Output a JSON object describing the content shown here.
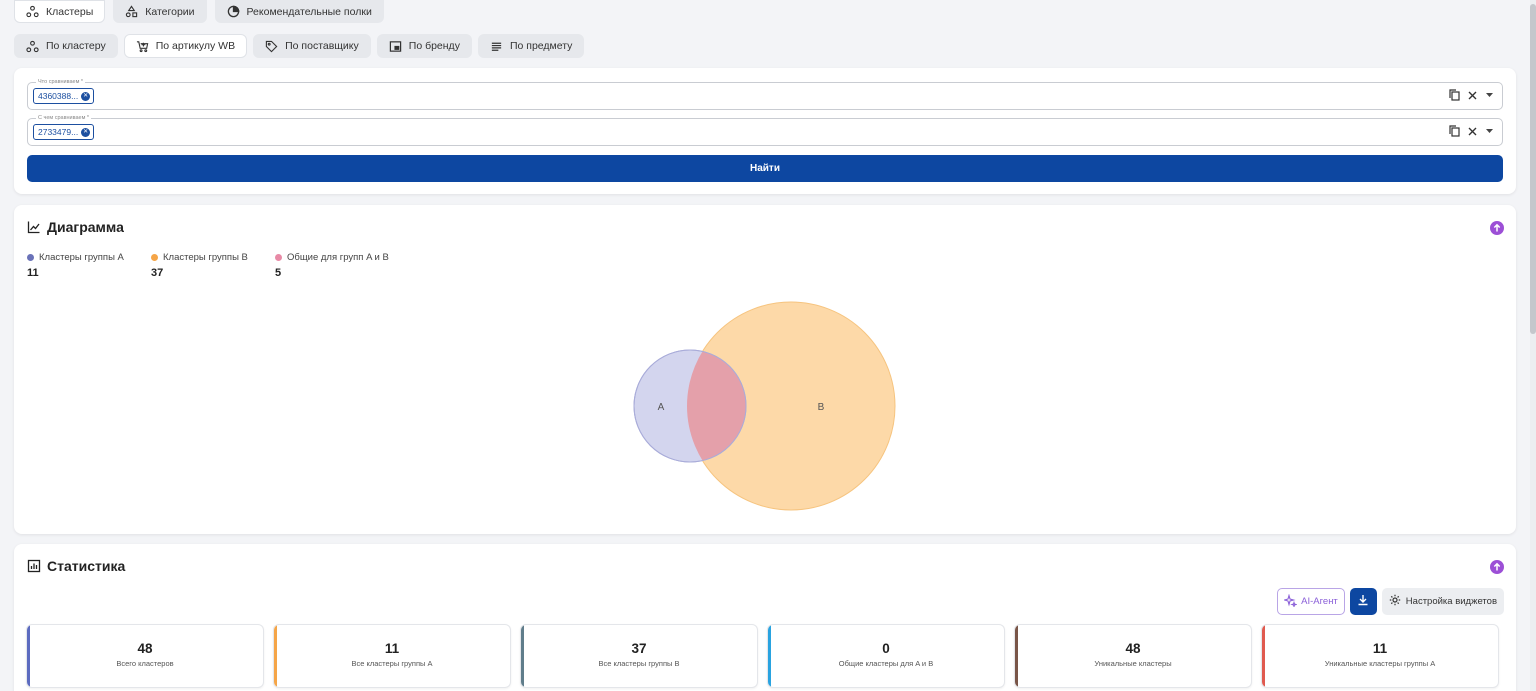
{
  "top_tabs": [
    {
      "label": "Кластеры",
      "icon": "clusters-icon",
      "active": true
    },
    {
      "label": "Категории",
      "icon": "categories-icon",
      "active": false
    },
    {
      "label": "Рекомендательные полки",
      "icon": "pie-icon",
      "active": false
    }
  ],
  "sub_tabs": [
    {
      "label": "По кластеру",
      "icon": "clusters-icon",
      "active": false
    },
    {
      "label": "По артикулу WB",
      "icon": "cart-icon",
      "active": true
    },
    {
      "label": "По поставщику",
      "icon": "tag-icon",
      "active": false
    },
    {
      "label": "По бренду",
      "icon": "brand-icon",
      "active": false
    },
    {
      "label": "По предмету",
      "icon": "lines-icon",
      "active": false
    }
  ],
  "search": {
    "field_a": {
      "label": "Что сравниваем *",
      "chip": "4360388..."
    },
    "field_b": {
      "label": "С чем сравниваем *",
      "chip": "2733479..."
    },
    "find_label": "Найти"
  },
  "diagram": {
    "title": "Диаграмма",
    "legend": [
      {
        "label": "Кластеры группы A",
        "value": "11",
        "color": "#6a72b8"
      },
      {
        "label": "Кластеры группы B",
        "value": "37",
        "color": "#f5a547"
      },
      {
        "label": "Общие для групп A и B",
        "value": "5",
        "color": "#e88aa6"
      }
    ],
    "venn": {
      "label_a": "A",
      "label_b": "B",
      "color_a": "#a9acd9",
      "color_b": "#fdcf8f",
      "color_overlap": "#e0909e",
      "size_a": 11,
      "size_b": 37,
      "overlap": 5
    }
  },
  "stats": {
    "title": "Статистика",
    "ai_label": "AI-Агент",
    "settings_label": "Настройка виджетов",
    "tiles": [
      {
        "value": "48",
        "label": "Всего кластеров",
        "color": "#5c6bc0"
      },
      {
        "value": "11",
        "label": "Все кластеры группы A",
        "color": "#f5a547"
      },
      {
        "value": "37",
        "label": "Все кластеры группы B",
        "color": "#607d8b"
      },
      {
        "value": "0",
        "label": "Общие кластеры для A и B",
        "color": "#29a3e0"
      },
      {
        "value": "48",
        "label": "Уникальные кластеры",
        "color": "#795548"
      },
      {
        "value": "11",
        "label": "Уникальные кластеры группы A",
        "color": "#e05a4f"
      }
    ]
  },
  "accent": "#0d47a1",
  "up_icon_color": "#9c4fd6"
}
